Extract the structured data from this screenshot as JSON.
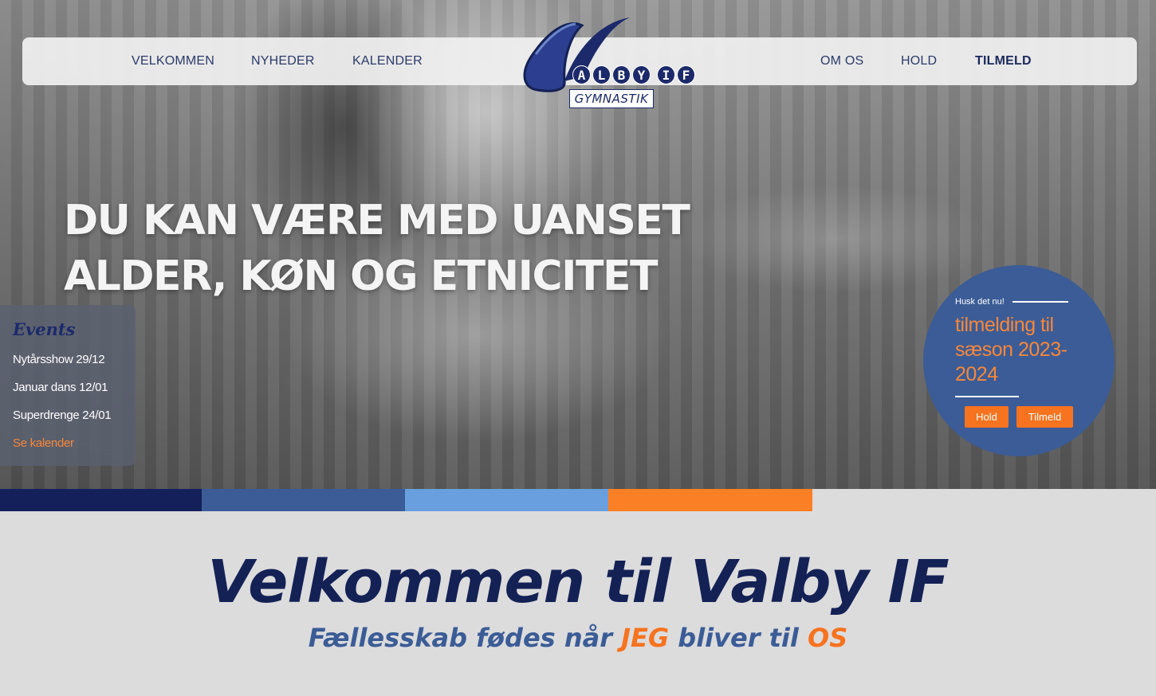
{
  "colors": {
    "navy": "#142155",
    "blue": "#3b5c96",
    "light_blue": "#6a9fdf",
    "orange": "#f7731f",
    "nav_bar": "#f0f0f0"
  },
  "nav": {
    "left_items": [
      "VELKOMMEN",
      "NYHEDER",
      "KALENDER"
    ],
    "right_items": [
      "OM OS",
      "HOLD",
      "TILMELD"
    ]
  },
  "logo": {
    "letters": [
      "A",
      "L",
      "B",
      "Y",
      "I",
      "F"
    ],
    "subtitle": "GYMNASTIK"
  },
  "hero": {
    "headline_line1": "DU KAN VÆRE MED UANSET",
    "headline_line2": "ALDER, KØN OG ETNICITET"
  },
  "events": {
    "title": "Events",
    "items": [
      "Nytårsshow 29/12",
      "Januar dans 12/01",
      "Superdrenge 24/01"
    ],
    "link": "Se kalender"
  },
  "promo": {
    "kicker": "Husk det nu!",
    "title": "tilmelding til sæson 2023-2024",
    "buttons": [
      "Hold",
      "Tilmeld"
    ]
  },
  "stripe_colors": [
    "#14205a",
    "#3b5c96",
    "#6a9fdf",
    "#fb7f25"
  ],
  "welcome": {
    "title": "Velkommen til Valby IF",
    "tagline_part1": "Fællesskab fødes når ",
    "tagline_hl1": "JEG",
    "tagline_part2": " bliver til ",
    "tagline_hl2": "OS"
  }
}
